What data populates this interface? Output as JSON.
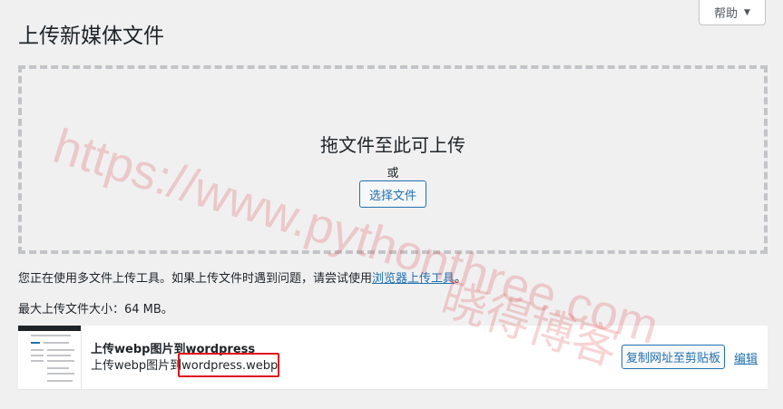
{
  "help_tab": {
    "label": "帮助",
    "arrow": "▼"
  },
  "page": {
    "title": "上传新媒体文件"
  },
  "drop_zone": {
    "instructions": "拖文件至此可上传",
    "or": "或",
    "select_button": "选择文件"
  },
  "notes": {
    "multi_prefix": "您正在使用多文件上传工具。如果上传文件时遇到问题，请尝试使用",
    "browser_uploader_link": "浏览器上传工具",
    "multi_suffix": "。",
    "max_size": "最大上传文件大小：64 MB。"
  },
  "media_item": {
    "title": "上传webp图片到wordpress",
    "filename_prefix": "上传webp图片到",
    "filename_highlight": "wordpress.webp",
    "copy_button": "复制网址至剪贴板",
    "edit_link": "编辑"
  },
  "watermarks": {
    "url": "https://www.pythonthree.com",
    "brand": "晓得博客"
  },
  "colors": {
    "accent": "#2271b1",
    "annotation_red": "#e0131b",
    "background": "#f0f0f1"
  }
}
